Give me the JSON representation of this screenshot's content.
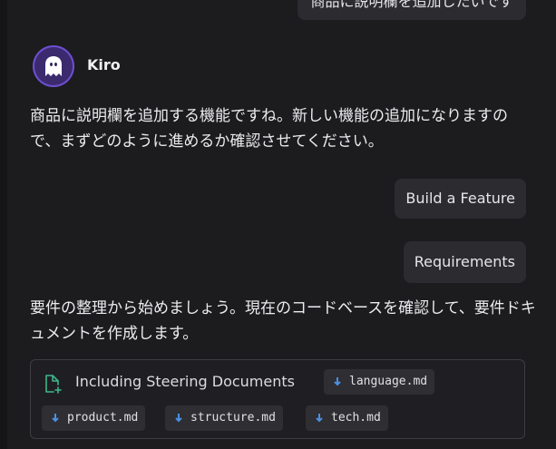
{
  "conversation": {
    "user_messages": {
      "top_partial": "商品に説明欄を追加したいです",
      "build_feature": "Build a Feature",
      "requirements": "Requirements"
    },
    "agent": {
      "name": "Kiro",
      "avatar_icon": "ghost-icon",
      "accent_color": "#6d4fd0",
      "message_1": "商品に説明欄を追加する機能ですね。新しい機能の追加になりますので、まずどのように進めるか確認させてください。",
      "message_2": "要件の整理から始めましょう。現在のコードベースを確認して、要件ドキュメントを作成します。"
    },
    "steering": {
      "label": "Including Steering Documents",
      "icon": "document-add-icon",
      "icon_color": "#3fb68b",
      "documents": [
        "language.md",
        "product.md",
        "structure.md",
        "tech.md"
      ],
      "doc_icon": "markdown-icon",
      "doc_icon_color": "#4a90e2"
    }
  }
}
